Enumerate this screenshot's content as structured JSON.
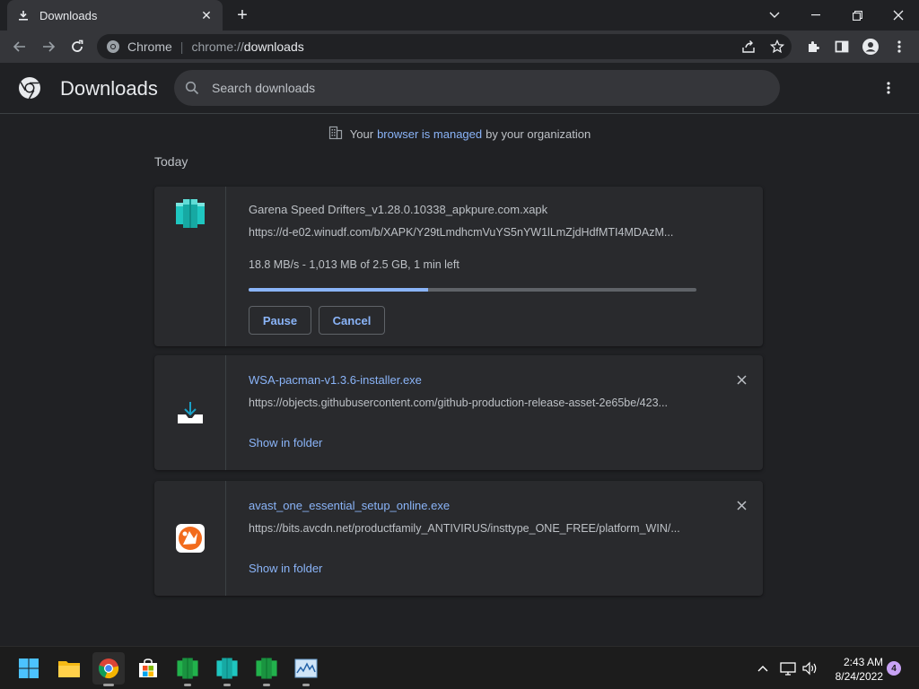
{
  "browser": {
    "tab_title": "Downloads",
    "site_label": "Chrome",
    "url_scheme": "chrome://",
    "url_host": "downloads"
  },
  "page": {
    "title": "Downloads",
    "search_placeholder": "Search downloads",
    "managed": {
      "pre": "Your",
      "link": "browser is managed",
      "post": "by your organization"
    },
    "section_label": "Today"
  },
  "downloads": [
    {
      "name": "Garena Speed Drifters_v1.28.0.10338_apkpure.com.xapk",
      "url": "https://d-e02.winudf.com/b/XAPK/Y29tLmdhcmVuYS5nYW1lLmZjdHdfMTI4MDAzM...",
      "status": "18.8 MB/s - 1,013 MB of 2.5 GB, 1 min left",
      "progress_percent": 40,
      "pause_label": "Pause",
      "cancel_label": "Cancel",
      "icon": "cube-icon",
      "icon_color": "#1fc6c0"
    },
    {
      "name": "WSA-pacman-v1.3.6-installer.exe",
      "url": "https://objects.githubusercontent.com/github-production-release-asset-2e65be/423...",
      "action_label": "Show in folder",
      "icon": "download-tray-icon"
    },
    {
      "name": "avast_one_essential_setup_online.exe",
      "url": "https://bits.avcdn.net/productfamily_ANTIVIRUS/insttype_ONE_FREE/platform_WIN/...",
      "action_label": "Show in folder",
      "icon": "avast-icon",
      "icon_color": "#f26b1d"
    }
  ],
  "taskbar": {
    "time": "2:43 AM",
    "date": "8/24/2022",
    "notification_count": "4"
  },
  "colors": {
    "accent": "#8ab4f8",
    "background": "#202124",
    "card": "#292a2d"
  }
}
